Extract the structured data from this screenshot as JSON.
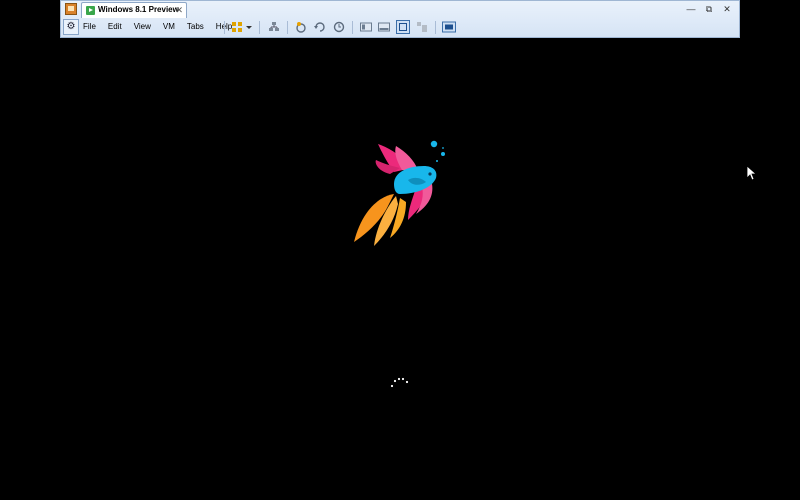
{
  "window": {
    "tab_title": "Windows 8.1 Preview",
    "tab_close": "✕",
    "controls": {
      "minimize": "—",
      "restore": "⧉",
      "close": "✕"
    }
  },
  "toolbar": {
    "menu": [
      "File",
      "Edit",
      "View",
      "VM",
      "Tabs",
      "Help"
    ],
    "icons": [
      "library-view-icon",
      "dropdown-arrow-icon",
      "network-icon",
      "snapshot-icon",
      "revert-snapshot-icon",
      "manage-snapshots-icon",
      "console-view-icon",
      "thumbnail-view-icon",
      "full-screen-icon",
      "unity-icon",
      "stretch-guest-icon"
    ]
  },
  "guest_screen": {
    "state": "Windows boot screen",
    "logo": "betta-fish-logo",
    "spinner": "loading-spinner"
  }
}
